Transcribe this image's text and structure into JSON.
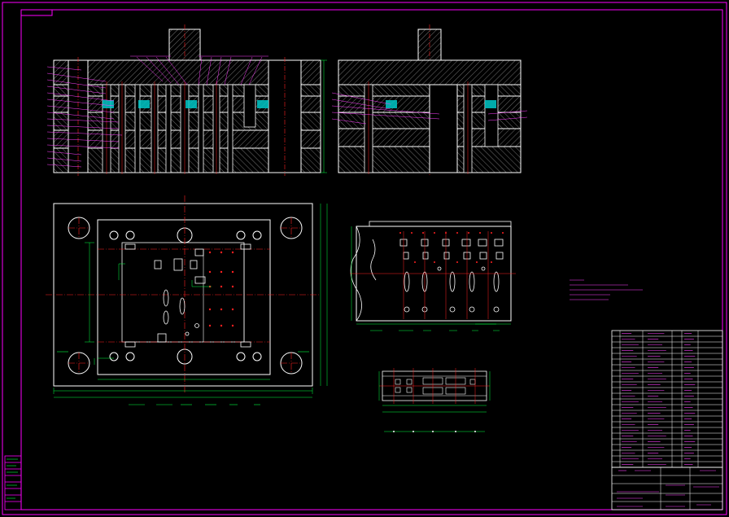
{
  "colors": {
    "background": "#000000",
    "frame": "#ff00ff",
    "outline": "#ffffff",
    "hatch": "#9a9a9a",
    "centerline": "#ff2020",
    "dimension": "#00ff40",
    "cyan": "#00c8c8",
    "note": "#ff40ff"
  },
  "drawing": {
    "views": [
      "front-section-view",
      "side-section-view",
      "lower-die-plan-view",
      "upper-die-plan-view",
      "strip-layout-view"
    ],
    "title_block": {
      "rows": 24,
      "columns": 6
    }
  }
}
